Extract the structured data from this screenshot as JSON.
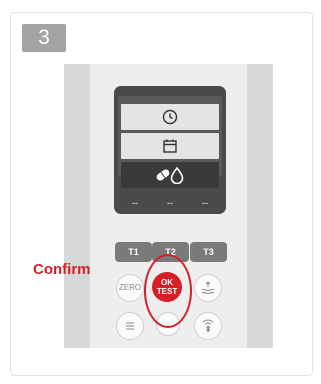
{
  "step": {
    "number": "3"
  },
  "annotation": {
    "label": "Confirm",
    "color": "#d61f26"
  },
  "lcd": {
    "rows": [
      {
        "icon": "clock-icon"
      },
      {
        "icon": "calendar-icon"
      },
      {
        "icon": "pill-drop-icon",
        "selected": true
      }
    ],
    "soft_keys": [
      "--",
      "--",
      "--"
    ]
  },
  "keypad": {
    "t1": "T1",
    "t2": "T2",
    "t3": "T3",
    "zero": "ZERO",
    "ok_line1": "OK",
    "ok_line2": "TEST"
  }
}
